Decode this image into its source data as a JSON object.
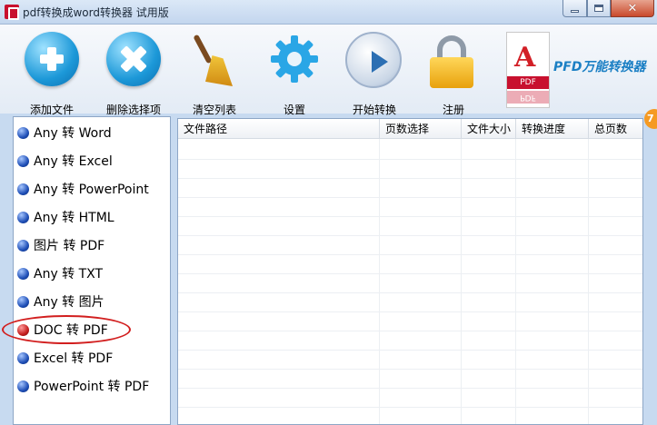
{
  "window": {
    "title": "pdf转换成word转换器 试用版"
  },
  "toolbar": {
    "add_file": "添加文件",
    "remove_selected": "删除选择项",
    "clear_list": "清空列表",
    "settings": "设置",
    "start_convert": "开始转换",
    "register": "注册",
    "brand": "PFD万能转换器",
    "brand_pdf_label": "PDF"
  },
  "sidebar": {
    "items": [
      {
        "label": "Any 转 Word",
        "selected": false
      },
      {
        "label": "Any 转 Excel",
        "selected": false
      },
      {
        "label": "Any 转 PowerPoint",
        "selected": false
      },
      {
        "label": "Any 转 HTML",
        "selected": false
      },
      {
        "label": "图片 转 PDF",
        "selected": false
      },
      {
        "label": "Any 转 TXT",
        "selected": false
      },
      {
        "label": "Any 转 图片",
        "selected": false
      },
      {
        "label": "DOC 转 PDF",
        "selected": true
      },
      {
        "label": "Excel 转 PDF",
        "selected": false
      },
      {
        "label": "PowerPoint 转 PDF",
        "selected": false
      }
    ]
  },
  "table": {
    "columns": [
      "文件路径",
      "页数选择",
      "文件大小",
      "转换进度",
      "总页数"
    ]
  },
  "badge": {
    "text": "7"
  },
  "colors": {
    "accent_blue": "#1c98d8",
    "highlight_red": "#d21f1f",
    "brand_blue": "#1b7fc4"
  },
  "icons": [
    "plus-circle-icon",
    "x-circle-icon",
    "broom-icon",
    "gear-icon",
    "play-icon",
    "lock-icon",
    "pdf-logo-icon"
  ]
}
